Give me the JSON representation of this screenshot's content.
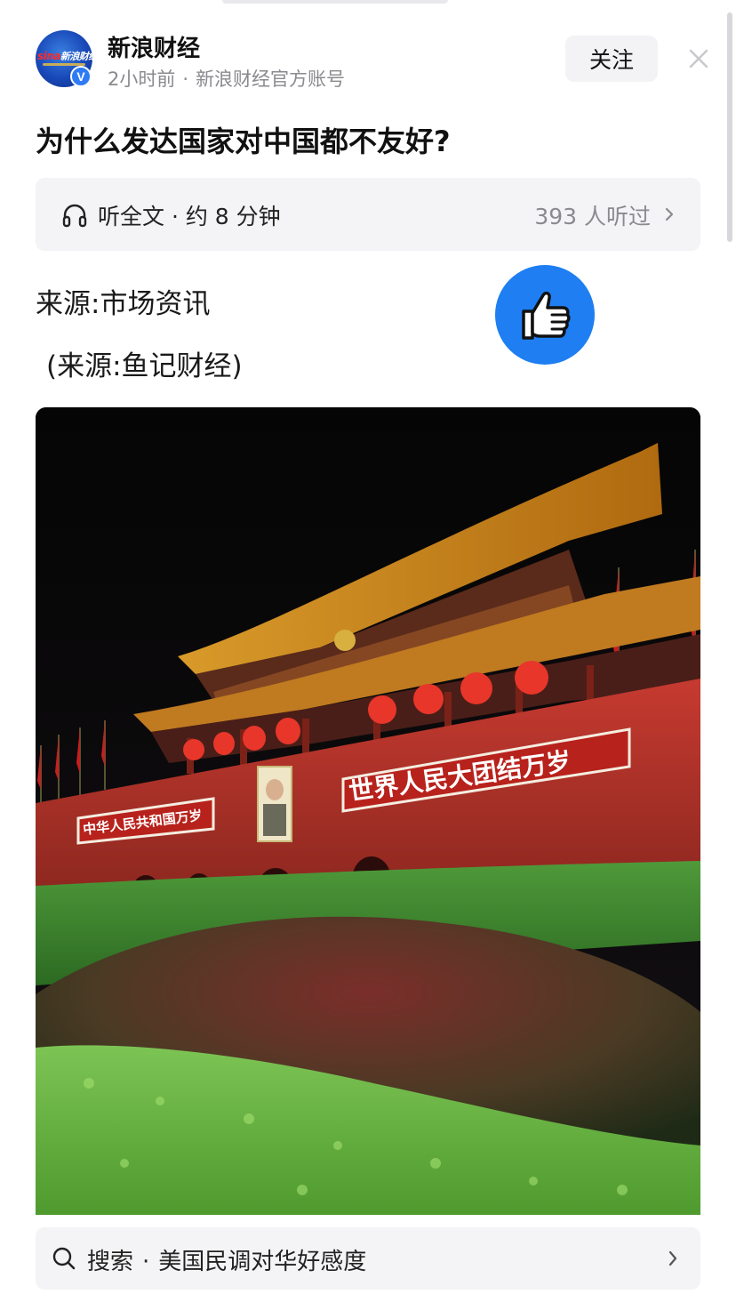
{
  "header": {
    "account_name": "新浪财经",
    "time_ago": "2小时前",
    "separator": "·",
    "account_type": "新浪财经官方账号",
    "follow_label": "关注",
    "avatar_text": "新浪财经",
    "avatar_brand": "sina",
    "verified_mark": "V"
  },
  "article": {
    "title": "为什么发达国家对中国都不友好?",
    "listen": {
      "label": "听全文 · 约 8 分钟",
      "count": "393 人听过"
    },
    "source_line": "来源:市场资讯",
    "source_line_2": "(来源:鱼记财经)"
  },
  "image": {
    "banner_left": "中华人民共和国万岁",
    "banner_right": "世界人民大团结万岁"
  },
  "search": {
    "prefix": "搜索",
    "separator": "·",
    "query": "美国民调对华好感度"
  },
  "icons": {
    "like": "thumbs-up-icon",
    "close": "close-icon",
    "listen": "headphone-icon",
    "search": "search-icon",
    "chevron": "chevron-right-icon"
  },
  "colors": {
    "accent_blue": "#1e7ef2",
    "verified_blue": "#2f7bf5",
    "muted_text": "#8a8a8f",
    "panel_bg": "#f4f4f6"
  }
}
